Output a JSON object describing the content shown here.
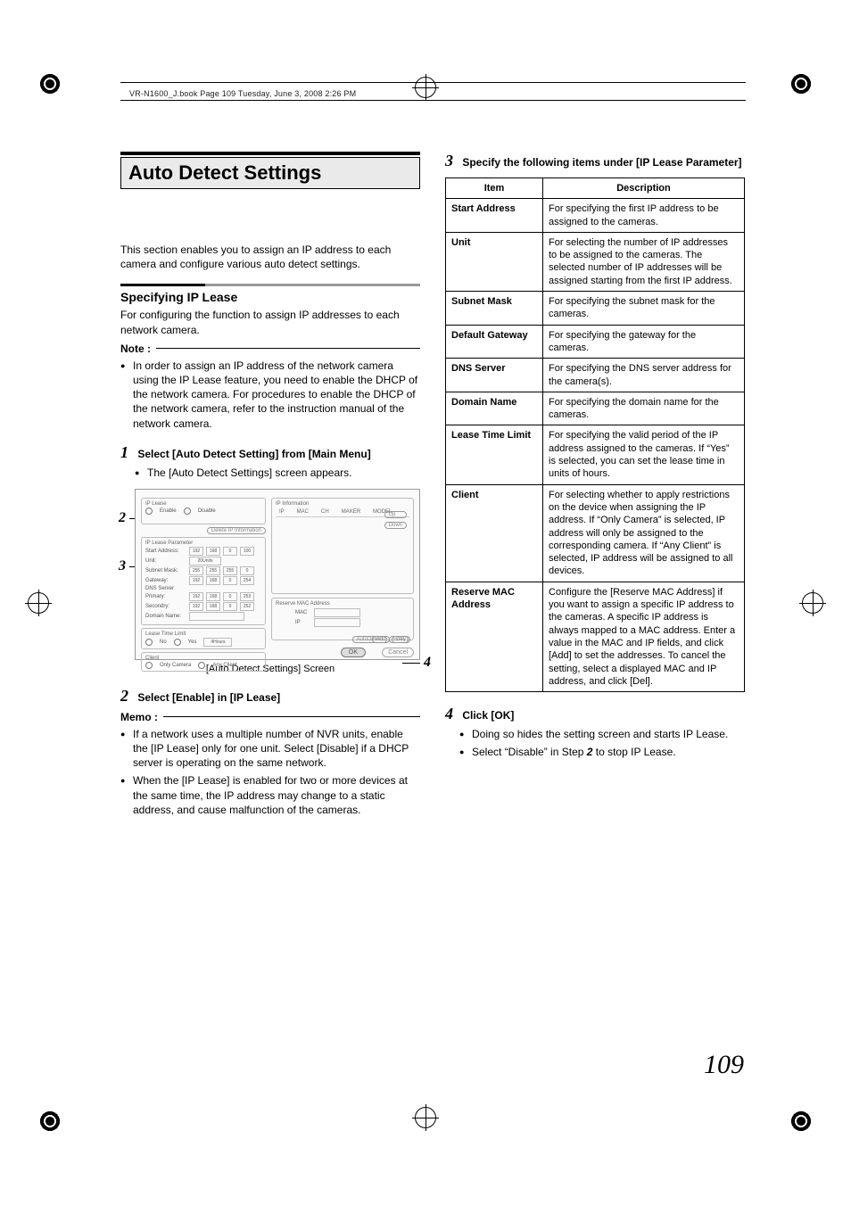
{
  "header": "VR-N1600_J.book  Page 109  Tuesday, June 3, 2008  2:26 PM",
  "section_title": "Auto Detect Settings",
  "intro": "This section enables you to assign an IP address to each camera and configure various auto detect settings.",
  "sub_heading": "Specifying IP Lease",
  "sub_intro": "For configuring the function to assign IP addresses to each network camera.",
  "note_label": "Note :",
  "note_bullet": "In order to assign an IP address of the network camera using the IP Lease feature, you need to enable the DHCP of the network camera.  For procedures to enable the DHCP of the network camera, refer to the instruction manual of the network camera.",
  "step1_num": "1",
  "step1_title": "Select [Auto Detect Setting] from [Main Menu]",
  "step1_bullet": "The [Auto Detect Settings] screen appears.",
  "screenshot_caption": "[Auto Detect Settings] Screen",
  "callouts": {
    "c2": "2",
    "c3": "3",
    "c4": "4"
  },
  "step2_num": "2",
  "step2_title": "Select [Enable] in [IP Lease]",
  "memo_label": "Memo :",
  "step2_bullets": [
    "If a network uses a multiple number of NVR units, enable the [IP Lease] only for one unit.  Select [Disable] if a DHCP server is operating on the same network.",
    "When the [IP Lease] is enabled for two or more devices at the same time, the IP address may change to a static address, and cause malfunction of the cameras."
  ],
  "step3_num": "3",
  "step3_title": "Specify the following items under [IP Lease Parameter]",
  "table_headers": {
    "item": "Item",
    "desc": "Description"
  },
  "table_rows": [
    {
      "item": "Start Address",
      "desc": "For specifying the first IP address to be assigned to the cameras."
    },
    {
      "item": "Unit",
      "desc": "For selecting the number of IP addresses to be assigned to the cameras.  The selected number of IP addresses will be assigned starting from the first IP address."
    },
    {
      "item": "Subnet Mask",
      "desc": "For specifying the subnet mask for the cameras."
    },
    {
      "item": "Default Gateway",
      "desc": "For specifying the gateway for the cameras."
    },
    {
      "item": "DNS Server",
      "desc": "For specifying the DNS server address for the camera(s)."
    },
    {
      "item": "Domain Name",
      "desc": "For specifying the domain name for the cameras."
    },
    {
      "item": "Lease Time Limit",
      "desc": "For specifying the valid period of the IP address assigned to the cameras.  If “Yes” is selected, you can set the lease time in units of hours."
    },
    {
      "item": "Client",
      "desc": "For selecting whether to apply restrictions on the device when assigning the IP address.  If “Only Camera” is selected, IP address will only be assigned to the corresponding camera.  If “Any Client” is selected, IP address will be assigned to all devices."
    },
    {
      "item": "Reserve MAC Address",
      "desc": "Configure the [Reserve MAC Address] if you want to assign a specific IP address to the cameras.  A specific IP address is always mapped to a MAC address.  Enter a value in the MAC and IP fields, and click [Add] to set the addresses.  To cancel the setting, select a displayed MAC and IP address, and click [Del]."
    }
  ],
  "step4_num": "4",
  "step4_title": "Click [OK]",
  "step4_bullets": [
    "Doing so hides the setting screen and starts IP Lease.",
    "Select “Disable” in Step 2 to stop IP Lease."
  ],
  "page_number": "109",
  "shot": {
    "ip_lease": "IP Lease",
    "enable": "Enable",
    "disable": "Disable",
    "delete_ip": "Delete IP Information",
    "param_title": "IP Lease Parameter",
    "start_addr": "Start Address:",
    "unit": "Unit:",
    "unit_val": "20Units",
    "subnet": "Subnet Mask:",
    "gateway": "Gateway:",
    "dns": "DNS Server",
    "primary": "Primary:",
    "secondary": "Secondry:",
    "domain": "Domain Name:",
    "lease_limit": "Lease Time Limit",
    "no": "No",
    "yes": "Yes",
    "hours": "4Hours",
    "client": "Client",
    "only_cam": "Only Camera",
    "any_client": "Any Client",
    "ip_info": "IP Information",
    "col_ip": "IP",
    "col_mac": "MAC",
    "col_ch": "CH",
    "col_maker": "MAKER",
    "col_model": "MODEL",
    "up": "Up",
    "down": "Down",
    "autodetect": "AutoDetect",
    "entry": "Entry",
    "reserve": "Reserve MAC Address",
    "mac": "MAC",
    "iplbl": "IP",
    "add": "Add",
    "del": "Del",
    "ok": "OK",
    "cancel": "Cancel",
    "ip1": [
      "192",
      "168",
      "0",
      "100"
    ],
    "ip2": [
      "255",
      "255",
      "255",
      "0"
    ],
    "ip3": [
      "192",
      "168",
      "0",
      "254"
    ],
    "ip4": [
      "192",
      "168",
      "0",
      "253"
    ],
    "ip5": [
      "192",
      "168",
      "0",
      "252"
    ]
  }
}
